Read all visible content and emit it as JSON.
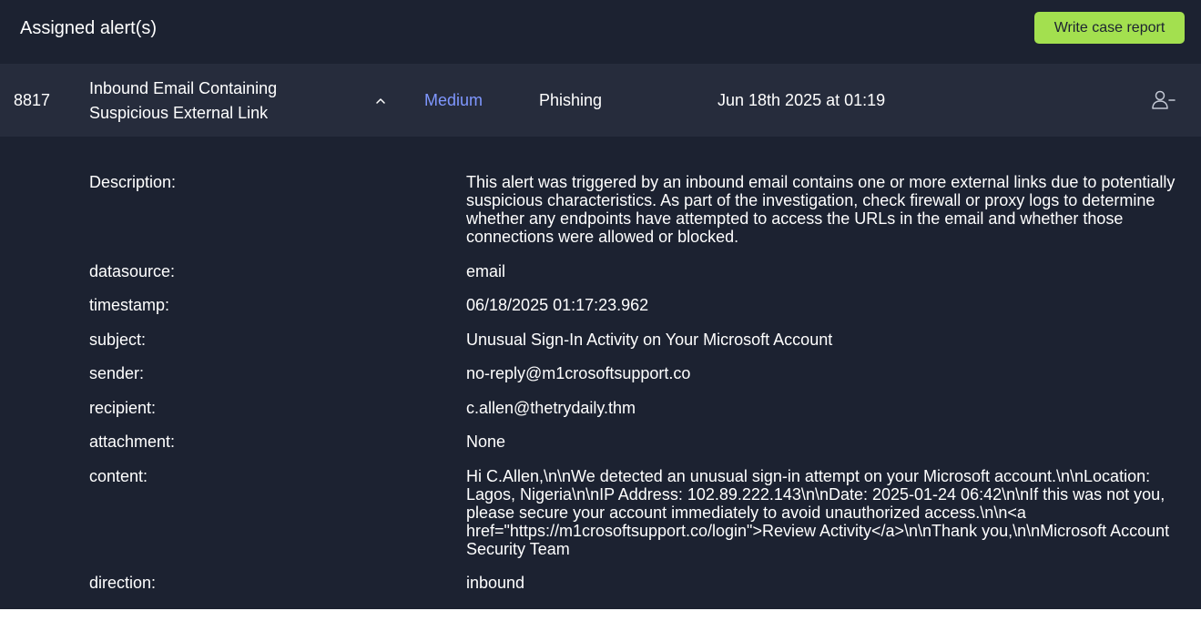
{
  "header": {
    "title": "Assigned alert(s)",
    "report_button_label": "Write case report"
  },
  "alert": {
    "id": "8817",
    "title": "Inbound Email Containing Suspicious External Link",
    "severity": "Medium",
    "category": "Phishing",
    "date": "Jun 18th 2025 at 01:19",
    "expand_icon": "chevron-up-icon",
    "unassign_icon": "user-minus-icon"
  },
  "details": [
    {
      "label": "Description:",
      "value": "This alert was triggered by an inbound email contains one or more external links due to potentially suspicious characteristics. As part of the investigation, check firewall or proxy logs to determine whether any endpoints have attempted to access the URLs in the email and whether those connections were allowed or blocked."
    },
    {
      "label": "datasource:",
      "value": "email"
    },
    {
      "label": "timestamp:",
      "value": "06/18/2025 01:17:23.962"
    },
    {
      "label": "subject:",
      "value": "Unusual Sign-In Activity on Your Microsoft Account"
    },
    {
      "label": "sender:",
      "value": "no-reply@m1crosoftsupport.co"
    },
    {
      "label": "recipient:",
      "value": "c.allen@thetrydaily.thm"
    },
    {
      "label": "attachment:",
      "value": "None"
    },
    {
      "label": "content:",
      "value": "Hi C.Allen,\\n\\nWe detected an unusual sign-in attempt on your Microsoft account.\\n\\nLocation: Lagos, Nigeria\\n\\nIP Address: 102.89.222.143\\n\\nDate: 2025-01-24 06:42\\n\\nIf this was not you, please secure your account immediately to avoid unauthorized access.\\n\\n<a href=\"https://m1crosoftsupport.co/login\">Review Activity</a>\\n\\nThank you,\\n\\nMicrosoft Account Security Team"
    },
    {
      "label": "direction:",
      "value": "inbound"
    }
  ],
  "colors": {
    "panel_bg": "#1c2231",
    "row_bg": "#262c3c",
    "accent_green": "#a3e04f",
    "severity_medium": "#7f97ff",
    "text": "#ffffff"
  }
}
